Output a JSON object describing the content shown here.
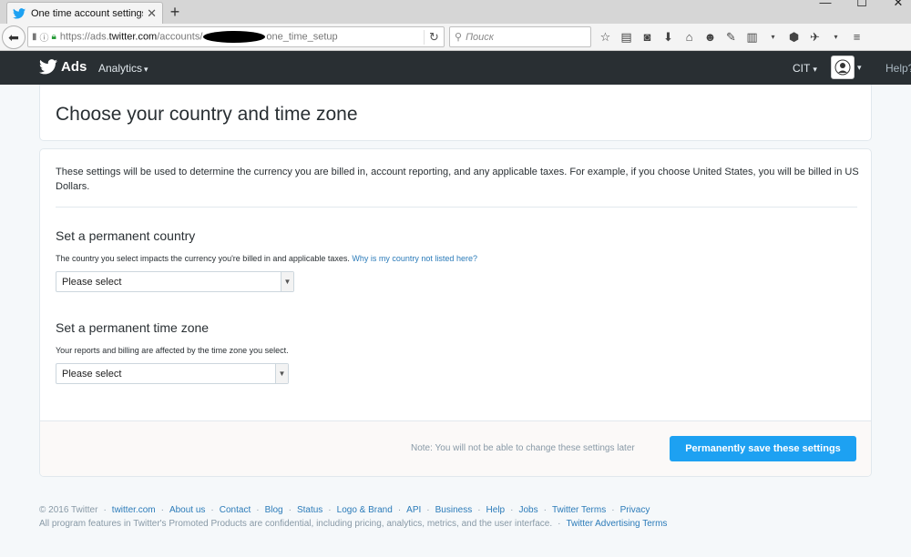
{
  "browser": {
    "tab_title": "One time account settings...",
    "url_prefix": "https://ads.",
    "url_host": "twitter.com",
    "url_path_start": "/accounts/",
    "url_path_end": "one_time_setup",
    "search_placeholder": "Поиск"
  },
  "header": {
    "logo_text": "Ads",
    "analytics_label": "Analytics",
    "account_label": "CIT",
    "help_label": "Help?"
  },
  "page": {
    "title": "Choose your country and time zone",
    "intro": "These settings will be used to determine the currency you are billed in, account reporting, and any applicable taxes. For example, if you choose United States, you will be billed in US Dollars.",
    "country": {
      "title": "Set a permanent country",
      "desc": "The country you select impacts the currency you're billed in and applicable taxes.",
      "link": "Why is my country not listed here?",
      "select_value": "Please select"
    },
    "timezone": {
      "title": "Set a permanent time zone",
      "desc": "Your reports and billing are affected by the time zone you select.",
      "select_value": "Please select"
    },
    "note": "Note: You will not be able to change these settings later",
    "save_label": "Permanently save these settings"
  },
  "footer": {
    "copyright": "© 2016 Twitter",
    "links": [
      "twitter.com",
      "About us",
      "Contact",
      "Blog",
      "Status",
      "Logo & Brand",
      "API",
      "Business",
      "Help",
      "Jobs",
      "Twitter Terms",
      "Privacy"
    ],
    "disclaimer": "All program features in Twitter's Promoted Products are confidential, including pricing, analytics, metrics, and the user interface.",
    "ads_terms": "Twitter Advertising Terms"
  },
  "colors": {
    "header_bg": "#292f33",
    "accent": "#1da1f2",
    "link": "#2b7bb9"
  }
}
